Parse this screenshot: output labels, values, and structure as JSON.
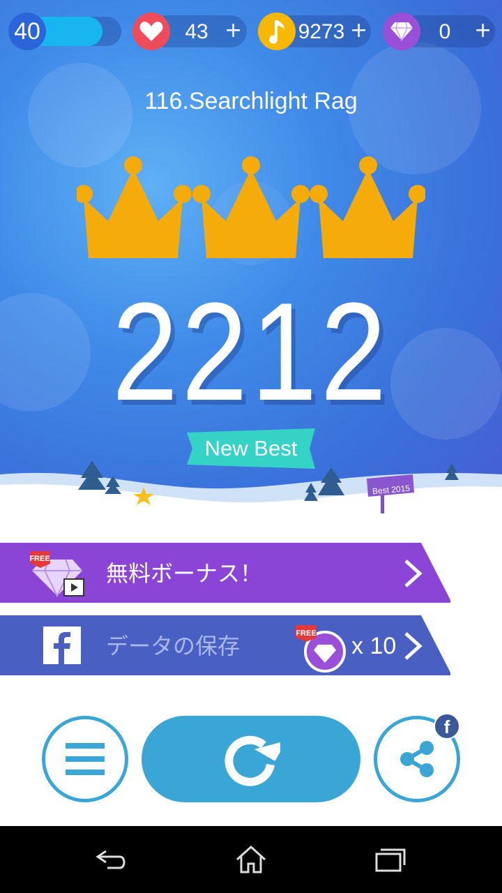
{
  "status": {
    "level": "40",
    "level_progress": 0.8,
    "hearts": "43",
    "notes": "9273",
    "diamonds": "0",
    "plus": "+",
    "icons": [
      "heart-icon",
      "music-note-icon",
      "diamond-icon"
    ]
  },
  "song": {
    "title": "116.Searchlight Rag"
  },
  "result": {
    "crowns": 3,
    "score": "2212",
    "new_best_label": "New Best",
    "sign_label": "Best 2015"
  },
  "actions": {
    "free_bonus": {
      "badge": "FREE",
      "label": "無料ボーナス！"
    },
    "save_data": {
      "label": "データの保存",
      "badge": "FREE",
      "reward": "x 10"
    },
    "fb_badge": "f"
  },
  "colors": {
    "purple_bar": "#8a44d6",
    "blue_bar": "#4a5fc2",
    "crown": "#f5ab0a",
    "ribbon": "#34d3c6",
    "button": "#3aa6d6",
    "heart": "#ee4b5b",
    "note": "#f9b800",
    "diamond": "#9a4fd8"
  }
}
